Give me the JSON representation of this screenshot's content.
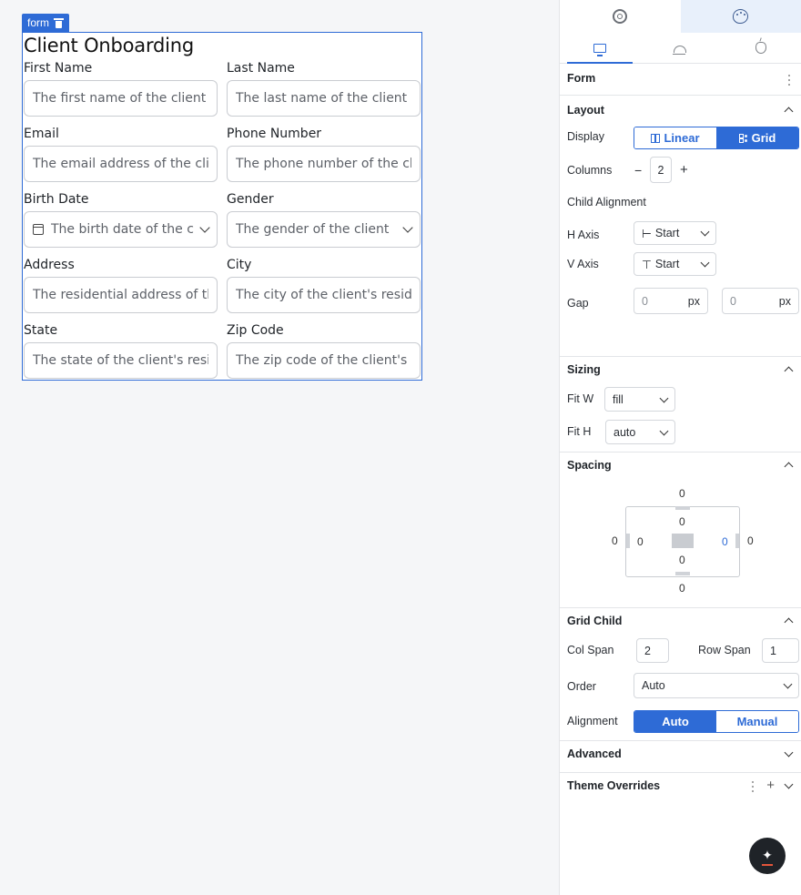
{
  "canvas": {
    "tag_label": "form",
    "title": "Client Onboarding",
    "fields": [
      {
        "label": "First Name",
        "placeholder": "The first name of the client"
      },
      {
        "label": "Last Name",
        "placeholder": "The last name of the client"
      },
      {
        "label": "Email",
        "placeholder": "The email address of the client"
      },
      {
        "label": "Phone Number",
        "placeholder": "The phone number of the client"
      },
      {
        "label": "Birth Date",
        "placeholder": "The birth date of the client"
      },
      {
        "label": "Gender",
        "placeholder": "The gender of the client"
      },
      {
        "label": "Address",
        "placeholder": "The residential address of the client"
      },
      {
        "label": "City",
        "placeholder": "The city of the client's residence"
      },
      {
        "label": "State",
        "placeholder": "The state of the client's residence"
      },
      {
        "label": "Zip Code",
        "placeholder": "The zip code of the client's residence"
      }
    ]
  },
  "panel": {
    "header": "Form",
    "layout": {
      "title": "Layout",
      "display_label": "Display",
      "display_options": [
        "Linear",
        "Grid"
      ],
      "display_selected": "Grid",
      "columns_label": "Columns",
      "columns_minus": "−",
      "columns_value": "2",
      "columns_plus": "+",
      "child_alignment_label": "Child Alignment",
      "h_axis_label": "H Axis",
      "h_axis_value": "Start",
      "v_axis_label": "V Axis",
      "v_axis_value": "Start",
      "gap_label": "Gap",
      "gap_row_value": "0",
      "gap_col_value": "0",
      "gap_unit": "px"
    },
    "sizing": {
      "title": "Sizing",
      "fit_w_label": "Fit W",
      "fit_w_value": "fill",
      "fit_h_label": "Fit H",
      "fit_h_value": "auto"
    },
    "spacing": {
      "title": "Spacing",
      "margin_top": "0",
      "margin_bottom": "0",
      "margin_left": "0",
      "margin_right": "0",
      "padding_top": "0",
      "padding_bottom": "0",
      "padding_left": "0",
      "padding_right": "0"
    },
    "grid_child": {
      "title": "Grid Child",
      "col_span_label": "Col Span",
      "col_span_value": "2",
      "row_span_label": "Row Span",
      "row_span_value": "1",
      "order_label": "Order",
      "order_value": "Auto",
      "alignment_label": "Alignment",
      "alignment_options": [
        "Auto",
        "Manual"
      ],
      "alignment_selected": "Auto"
    },
    "advanced": {
      "title": "Advanced"
    },
    "theme_overrides": {
      "title": "Theme Overrides"
    }
  },
  "colors": {
    "accent": "#2e6bd6",
    "active_tab_bg": "#e8f0fb"
  }
}
